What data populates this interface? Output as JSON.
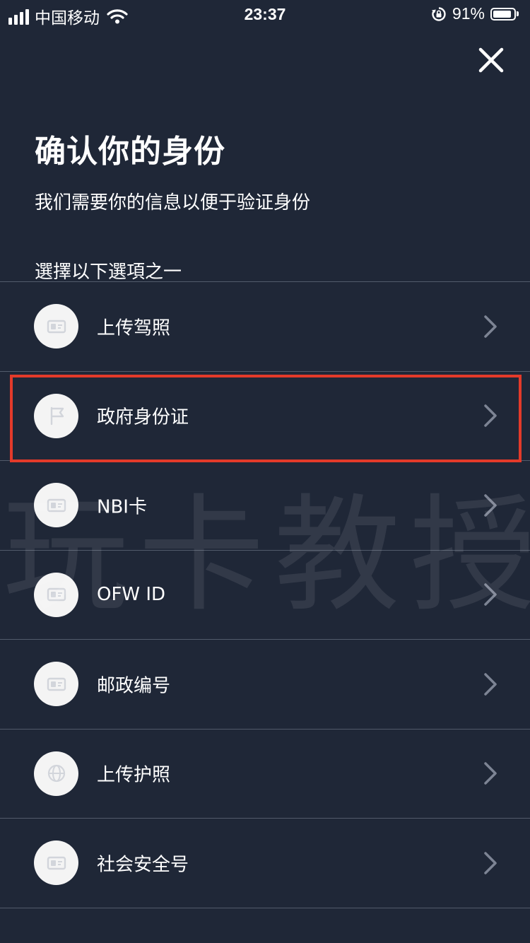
{
  "status_bar": {
    "carrier": "中国移动",
    "time": "23:37",
    "battery_percent": "91%",
    "battery_level": 0.91,
    "icons": [
      "signal-icon",
      "wifi-icon",
      "orientation-lock-icon",
      "battery-icon"
    ]
  },
  "close_icon": "close-icon",
  "header": {
    "title": "确认你的身份",
    "subtitle": "我们需要你的信息以便于验证身份",
    "section_label": "選擇以下選項之一"
  },
  "options": [
    {
      "label": "上传驾照",
      "icon": "id-card-icon"
    },
    {
      "label": "政府身份证",
      "icon": "flag-icon"
    },
    {
      "label": "NBI卡",
      "icon": "id-card-icon"
    },
    {
      "label": "OFW ID",
      "icon": "id-card-icon"
    },
    {
      "label": "邮政编号",
      "icon": "id-card-icon"
    },
    {
      "label": "上传护照",
      "icon": "globe-icon"
    },
    {
      "label": "社会安全号",
      "icon": "id-card-icon"
    }
  ],
  "highlighted_option": "政府身份证",
  "watermark": "玩卡教授",
  "colors": {
    "background": "#1f2737",
    "divider": "#525b6b",
    "icon_circle": "#f4f4f4",
    "icon_glyph": "#d2d5db",
    "chevron": "#7d8494",
    "highlight": "#e33a2a"
  }
}
